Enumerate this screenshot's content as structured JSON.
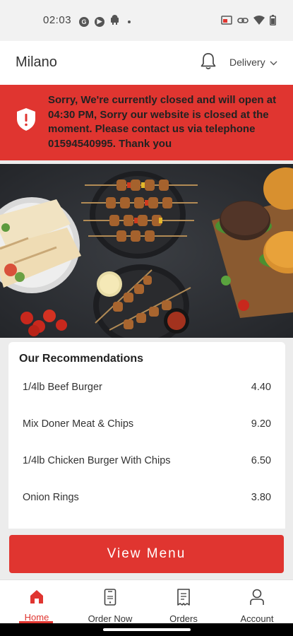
{
  "status_bar": {
    "time": "02:03",
    "left_icons": [
      "g-icon",
      "play-icon",
      "android-icon",
      "dot-icon"
    ],
    "right_icons": [
      "cast-icon",
      "link-icon",
      "wifi-icon",
      "battery-icon"
    ]
  },
  "header": {
    "title": "Milano",
    "delivery_label": "Delivery"
  },
  "closed_notice": {
    "text": "Sorry, We're currently closed and will open at 04:30 PM, Sorry our website is closed at the moment. Please contact us via telephone 01594540995. Thank you"
  },
  "recommendations": {
    "title": "Our Recommendations",
    "items": [
      {
        "name": "1/4lb Beef Burger",
        "price": "4.40"
      },
      {
        "name": "Mix Doner Meat & Chips",
        "price": "9.20"
      },
      {
        "name": "1/4lb Chicken Burger With Chips",
        "price": "6.50"
      },
      {
        "name": "Onion Rings",
        "price": "3.80"
      }
    ]
  },
  "view_menu_label": "View Menu",
  "bottom_nav": {
    "items": [
      {
        "label": "Home",
        "icon": "home-icon",
        "active": true
      },
      {
        "label": "Order Now",
        "icon": "phone-icon",
        "active": false
      },
      {
        "label": "Orders",
        "icon": "receipt-icon",
        "active": false
      },
      {
        "label": "Account",
        "icon": "user-icon",
        "active": false
      }
    ]
  },
  "colors": {
    "accent": "#e03530",
    "background": "#ececec"
  }
}
